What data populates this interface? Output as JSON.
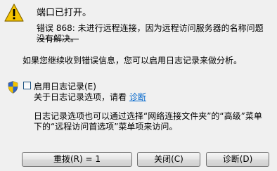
{
  "dialog": {
    "title": "端口已打开。",
    "error_line1": "错误 868: 未进行远程连接，因为远程访问服务器的名称问题",
    "error_line2": "没有解决。",
    "info": "如果您继续收到错误信息，您可以启用日志记录来做分析。"
  },
  "logging": {
    "checkbox_label": "启用日志记录(E)",
    "about_prefix": "关于日志记录选项，请看",
    "about_link": "诊断",
    "desc_line1": "日志记录选项也可以通过选择“网络连接文件夹”的“高级”菜单",
    "desc_line2": "下的“远程访问首选项”菜单项来访问。"
  },
  "buttons": {
    "redial": "重拨(R) = 1",
    "close": "关闭(C)",
    "diagnose": "诊断(D)"
  },
  "icons": {
    "warning": "warning-icon",
    "shield": "uac-shield-icon"
  },
  "colors": {
    "link": "#0066cc",
    "warning": "#f5c400",
    "background": "#f0f0f0"
  }
}
